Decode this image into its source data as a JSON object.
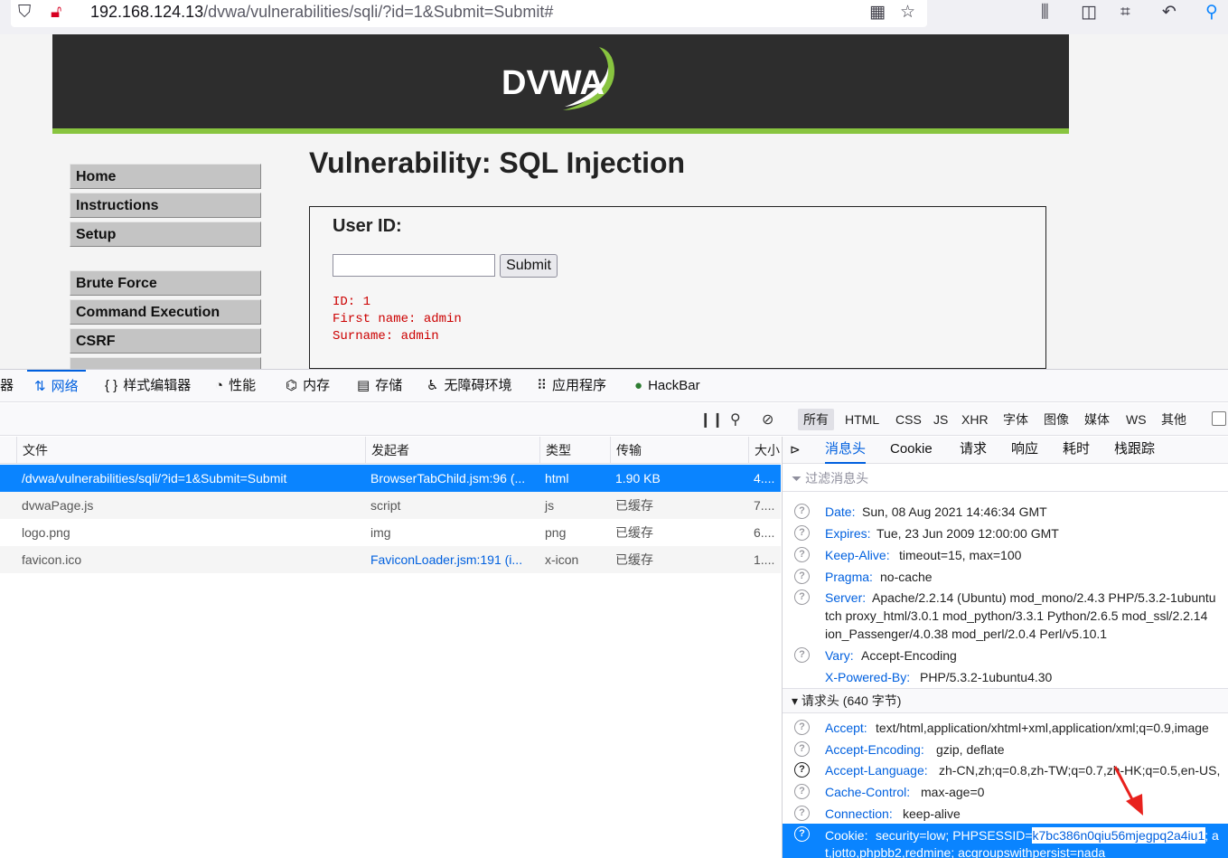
{
  "browser": {
    "url_host": "192.168.124.13",
    "url_path": "/dvwa/vulnerabilities/sqli/?id=1&Submit=Submit#"
  },
  "dvwa": {
    "logo_text": "DVWA",
    "menu": {
      "group1": [
        "Home",
        "Instructions",
        "Setup"
      ],
      "group2": [
        "Brute Force",
        "Command Execution",
        "CSRF"
      ]
    },
    "title": "Vulnerability: SQL Injection",
    "form": {
      "heading": "User ID:",
      "input_value": "",
      "submit_label": "Submit"
    },
    "result": {
      "line1": "ID: 1",
      "line2": "First name: admin",
      "line3": "Surname: admin"
    }
  },
  "devtools": {
    "tabs": {
      "inspector": "器",
      "network": "网络",
      "style_editor": "样式编辑器",
      "performance": "性能",
      "memory": "内存",
      "storage": "存储",
      "accessibility": "无障碍环境",
      "application": "应用程序",
      "hackbar": "HackBar"
    },
    "filters": [
      "所有",
      "HTML",
      "CSS",
      "JS",
      "XHR",
      "字体",
      "图像",
      "媒体",
      "WS",
      "其他"
    ],
    "columns": [
      "文件",
      "发起者",
      "类型",
      "传输",
      "大小"
    ],
    "requests": [
      {
        "file": "/dvwa/vulnerabilities/sqli/?id=1&Submit=Submit",
        "initiator": "BrowserTabChild.jsm:96 (...",
        "type": "html",
        "transfer": "1.90 KB",
        "size": "4...."
      },
      {
        "file": "dvwaPage.js",
        "initiator": "script",
        "type": "js",
        "transfer": "已缓存",
        "size": "7...."
      },
      {
        "file": "logo.png",
        "initiator": "img",
        "type": "png",
        "transfer": "已缓存",
        "size": "6...."
      },
      {
        "file": "favicon.ico",
        "initiator": "FaviconLoader.jsm:191 (i...",
        "type": "x-icon",
        "transfer": "已缓存",
        "size": "1...."
      }
    ],
    "side_tabs": [
      "消息头",
      "Cookie",
      "请求",
      "响应",
      "耗时",
      "栈跟踪"
    ],
    "filter_placeholder": "过滤消息头",
    "response_headers": [
      {
        "key": "Date:",
        "value": "Sun, 08 Aug 2021 14:46:34 GMT"
      },
      {
        "key": "Expires:",
        "value": "Tue, 23 Jun 2009 12:00:00 GMT"
      },
      {
        "key": "Keep-Alive:",
        "value": "timeout=15, max=100"
      },
      {
        "key": "Pragma:",
        "value": "no-cache"
      },
      {
        "key": "Server:",
        "value": "Apache/2.2.14 (Ubuntu) mod_mono/2.4.3 PHP/5.3.2-1ubuntu"
      },
      {
        "key": "Vary:",
        "value": "Accept-Encoding"
      },
      {
        "key": "X-Powered-By:",
        "value": "PHP/5.3.2-1ubuntu4.30"
      }
    ],
    "server_cont1": "tch proxy_html/3.0.1 mod_python/3.3.1 Python/2.6.5 mod_ssl/2.2.14",
    "server_cont2": "ion_Passenger/4.0.38 mod_perl/2.0.4 Perl/v5.10.1",
    "request_section": "请求头 (640 字节)",
    "request_headers": [
      {
        "key": "Accept:",
        "value": "text/html,application/xhtml+xml,application/xml;q=0.9,image"
      },
      {
        "key": "Accept-Encoding:",
        "value": "gzip, deflate"
      },
      {
        "key": "Accept-Language:",
        "value": "zh-CN,zh;q=0.8,zh-TW;q=0.7,zh-HK;q=0.5,en-US,"
      },
      {
        "key": "Cache-Control:",
        "value": "max-age=0"
      },
      {
        "key": "Connection:",
        "value": "keep-alive"
      }
    ],
    "cookie": {
      "key": "Cookie:",
      "prefix": "security=low; PHPSESSID=",
      "session_id": "k7bc386n0qiu56mjegpq2a4iu1",
      "suffix": "; a",
      "cont": "t,jotto,phpbb2,redmine; acgroupswithpersist=nada"
    }
  },
  "colors": {
    "accent": "#0a84ff",
    "link": "#0060df",
    "dvwa_green": "#88c43f",
    "result_red": "#cc0000",
    "arrow_red": "#e8211d"
  }
}
